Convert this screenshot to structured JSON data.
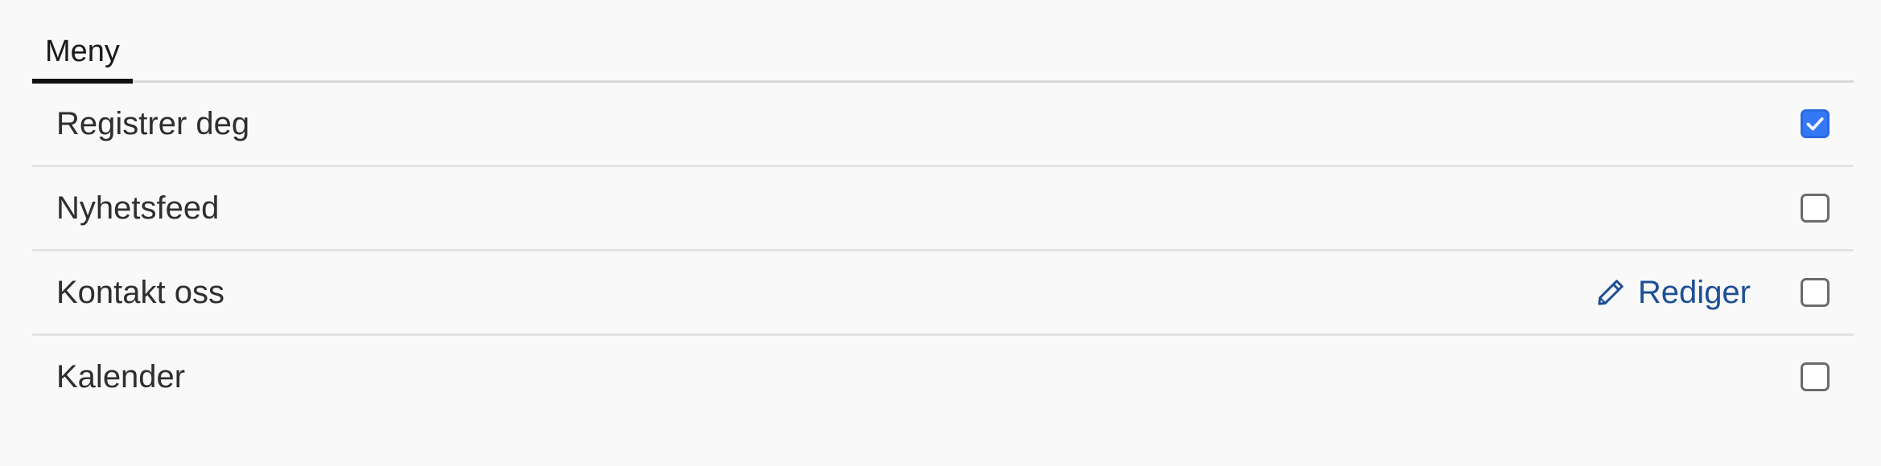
{
  "tabs": [
    {
      "label": "Meny",
      "active": true
    }
  ],
  "menu_items": [
    {
      "label": "Registrer deg",
      "checked": true,
      "edit_label": null
    },
    {
      "label": "Nyhetsfeed",
      "checked": false,
      "edit_label": null
    },
    {
      "label": "Kontakt oss",
      "checked": false,
      "edit_label": "Rediger"
    },
    {
      "label": "Kalender",
      "checked": false,
      "edit_label": null
    }
  ],
  "icons": {
    "edit": "pencil-icon",
    "check": "checkmark-icon"
  },
  "colors": {
    "accent": "#3478f6",
    "link": "#1c4f96",
    "text": "#2f2f2f",
    "background": "#f9f9f9"
  }
}
